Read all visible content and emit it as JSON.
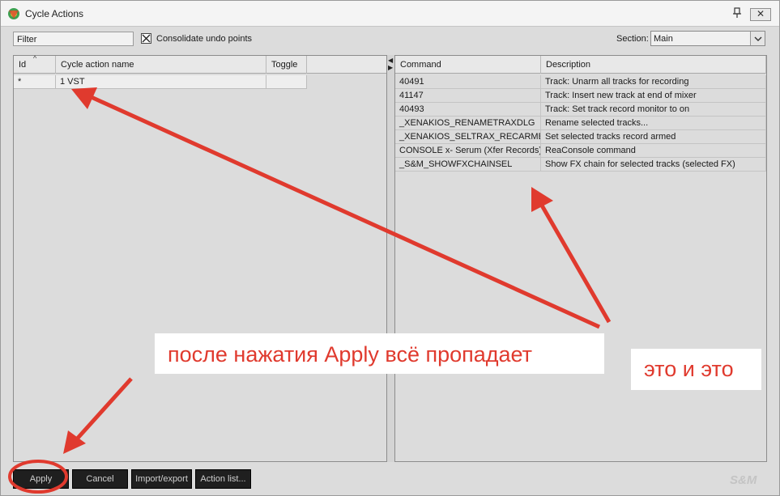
{
  "window": {
    "title": "Cycle Actions",
    "close_glyph": "✕",
    "icons": [
      "reaper-logo-icon",
      "pin-icon",
      "close-icon"
    ]
  },
  "toolbar": {
    "filter_label": "Filter",
    "consolidate_label": "Consolidate undo points",
    "consolidate_checked": true,
    "section_label": "Section:",
    "section_value": "Main"
  },
  "left_table": {
    "columns": [
      "Id",
      "Cycle action name",
      "Toggle"
    ],
    "rows": [
      {
        "id": "*",
        "name": "1  VST",
        "toggle": ""
      }
    ]
  },
  "right_table": {
    "columns": [
      "Command",
      "Description"
    ],
    "rows": [
      {
        "command": "40491",
        "description": "Track: Unarm all tracks for recording"
      },
      {
        "command": "41147",
        "description": "Track: Insert new track at end of mixer"
      },
      {
        "command": "40493",
        "description": "Track: Set track record monitor to on"
      },
      {
        "command": "_XENAKIOS_RENAMETRAXDLG",
        "description": "Rename selected tracks..."
      },
      {
        "command": "_XENAKIOS_SELTRAX_RECARMED",
        "description": "Set selected tracks record armed"
      },
      {
        "command": "CONSOLE x- Serum (Xfer Records)",
        "description": "ReaConsole command"
      },
      {
        "command": "_S&M_SHOWFXCHAINSEL",
        "description": "Show FX chain for selected tracks (selected FX)"
      }
    ]
  },
  "buttons": {
    "apply": "Apply",
    "cancel": "Cancel",
    "import_export": "Import/export",
    "action_list": "Action list..."
  },
  "brand": "S&M",
  "annotations": {
    "note_1": "после нажатия Apply всё пропадает",
    "note_2": "это и это",
    "color": "#e03a2e"
  }
}
